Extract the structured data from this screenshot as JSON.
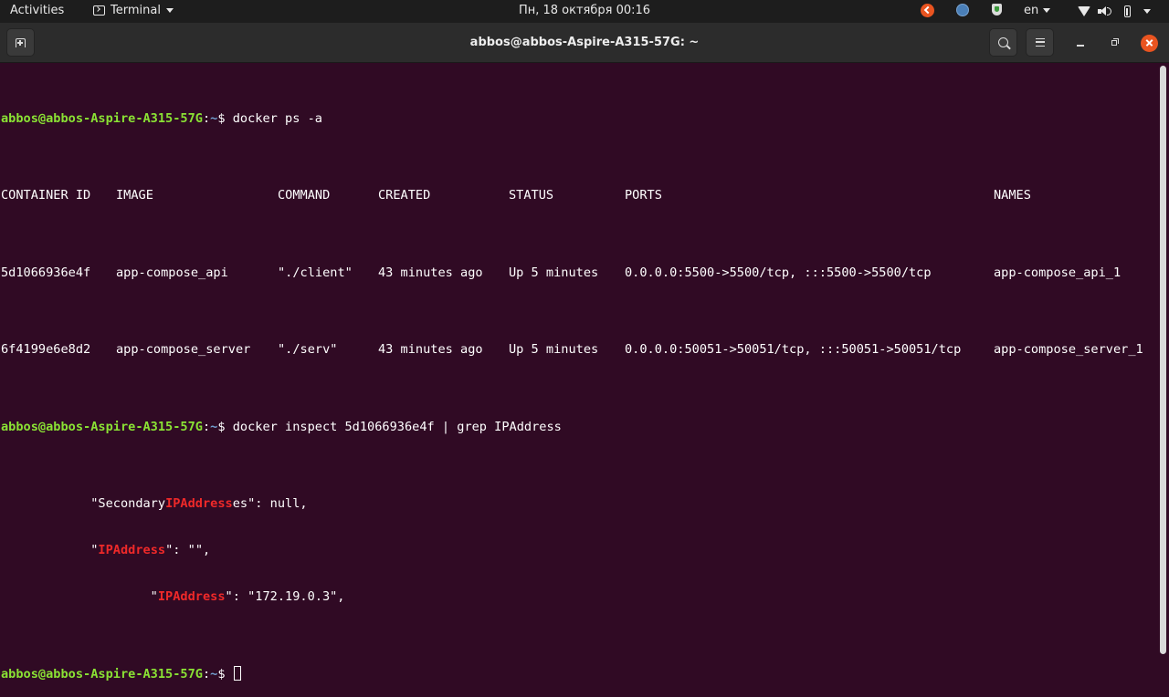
{
  "topbar": {
    "activities": "Activities",
    "app_name": "Terminal",
    "clock": "Пн, 18 октября  00:16",
    "keyboard_layout": "en"
  },
  "window": {
    "title": "abbos@abbos-Aspire-A315-57G: ~"
  },
  "terminal": {
    "prompt_user": "abbos@abbos-Aspire-A315-57G",
    "prompt_sep": ":",
    "prompt_path": "~",
    "prompt_symbol": "$ ",
    "command1": "docker ps -a",
    "ps_headers": [
      "CONTAINER ID",
      "IMAGE",
      "COMMAND",
      "CREATED",
      "STATUS",
      "PORTS",
      "NAMES"
    ],
    "ps_rows": [
      [
        "5d1066936e4f",
        "app-compose_api",
        "\"./client\"",
        "43 minutes ago",
        "Up 5 minutes",
        "0.0.0.0:5500->5500/tcp, :::5500->5500/tcp",
        "app-compose_api_1"
      ],
      [
        "6f4199e6e8d2",
        "app-compose_server",
        "\"./serv\"",
        "43 minutes ago",
        "Up 5 minutes",
        "0.0.0.0:50051->50051/tcp, :::50051->50051/tcp",
        "app-compose_server_1"
      ]
    ],
    "command2": "docker inspect 5d1066936e4f | grep IPAddress",
    "grep_match": "IPAddress",
    "out1_pre": "            \"Secondary",
    "out1_post": "es\": null,",
    "out2_pre": "            \"",
    "out2_post": "\": \"\",",
    "out3_pre": "                    \"",
    "out3_post": "\": \"172.19.0.3\","
  },
  "colors": {
    "terminal_bg": "#300a24",
    "prompt_user": "#8ae234",
    "prompt_path": "#729fcf",
    "grep_match": "#ef2929",
    "close_button": "#e95420"
  }
}
